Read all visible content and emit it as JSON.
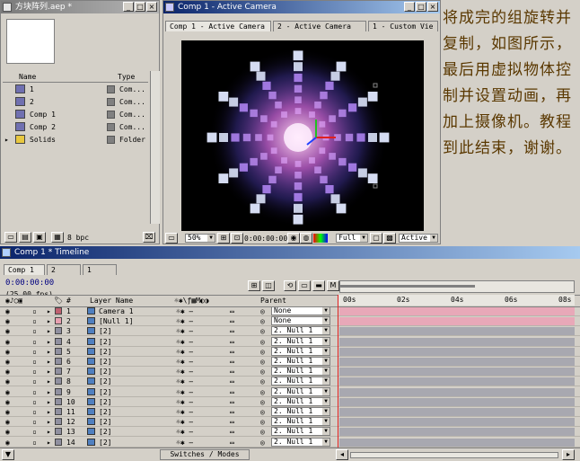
{
  "project": {
    "title": "方块阵列.aep *",
    "columns": {
      "name": "Name",
      "type": "Type"
    },
    "items": [
      {
        "name": "1",
        "type": "Com..."
      },
      {
        "name": "2",
        "type": "Com..."
      },
      {
        "name": "Comp 1",
        "type": "Com..."
      },
      {
        "name": "Comp 2",
        "type": "Com..."
      },
      {
        "name": "Solids",
        "type": "Folder"
      }
    ],
    "bpc": "8 bpc"
  },
  "comp": {
    "title": "Comp 1 - Active Camera",
    "tabs": [
      "Comp 1 - Active Camera",
      "2 - Active Camera",
      "1 - Custom Vie"
    ],
    "zoom": "50%",
    "timecode": "0:00:00:00",
    "resolution": "Full",
    "view": "Active"
  },
  "annotation": "将成完的组旋转并复制，如图所示，最后用虚拟物体控制并设置动画，再加上摄像机。教程到此结束，谢谢。",
  "timeline": {
    "title": "Comp 1 * Timeline",
    "tabs": [
      "Comp 1",
      "2",
      "1"
    ],
    "timecode": "0:00:00:00",
    "fps": "(25.00 fps)",
    "col_num": "#",
    "col_layer": "Layer Name",
    "col_parent": "Parent",
    "ruler": [
      "00s",
      "02s",
      "04s",
      "06s",
      "08s"
    ],
    "switches_label": "Switches / Modes",
    "layers": [
      {
        "num": "1",
        "name": "Camera 1",
        "parent": "None",
        "color": "#c06070"
      },
      {
        "num": "2",
        "name": "[Null 1]",
        "parent": "None",
        "color": "#e8a0b0"
      },
      {
        "num": "3",
        "name": "[2]",
        "parent": "2. Null 1",
        "color": "#9090a0"
      },
      {
        "num": "4",
        "name": "[2]",
        "parent": "2. Null 1",
        "color": "#9090a0"
      },
      {
        "num": "5",
        "name": "[2]",
        "parent": "2. Null 1",
        "color": "#9090a0"
      },
      {
        "num": "6",
        "name": "[2]",
        "parent": "2. Null 1",
        "color": "#9090a0"
      },
      {
        "num": "7",
        "name": "[2]",
        "parent": "2. Null 1",
        "color": "#9090a0"
      },
      {
        "num": "8",
        "name": "[2]",
        "parent": "2. Null 1",
        "color": "#9090a0"
      },
      {
        "num": "9",
        "name": "[2]",
        "parent": "2. Null 1",
        "color": "#9090a0"
      },
      {
        "num": "10",
        "name": "[2]",
        "parent": "2. Null 1",
        "color": "#9090a0"
      },
      {
        "num": "11",
        "name": "[2]",
        "parent": "2. Null 1",
        "color": "#9090a0"
      },
      {
        "num": "12",
        "name": "[2]",
        "parent": "2. Null 1",
        "color": "#9090a0"
      },
      {
        "num": "13",
        "name": "[2]",
        "parent": "2. Null 1",
        "color": "#9090a0"
      },
      {
        "num": "14",
        "name": "[2]",
        "parent": "2. Null 1",
        "color": "#9090a0"
      }
    ]
  }
}
